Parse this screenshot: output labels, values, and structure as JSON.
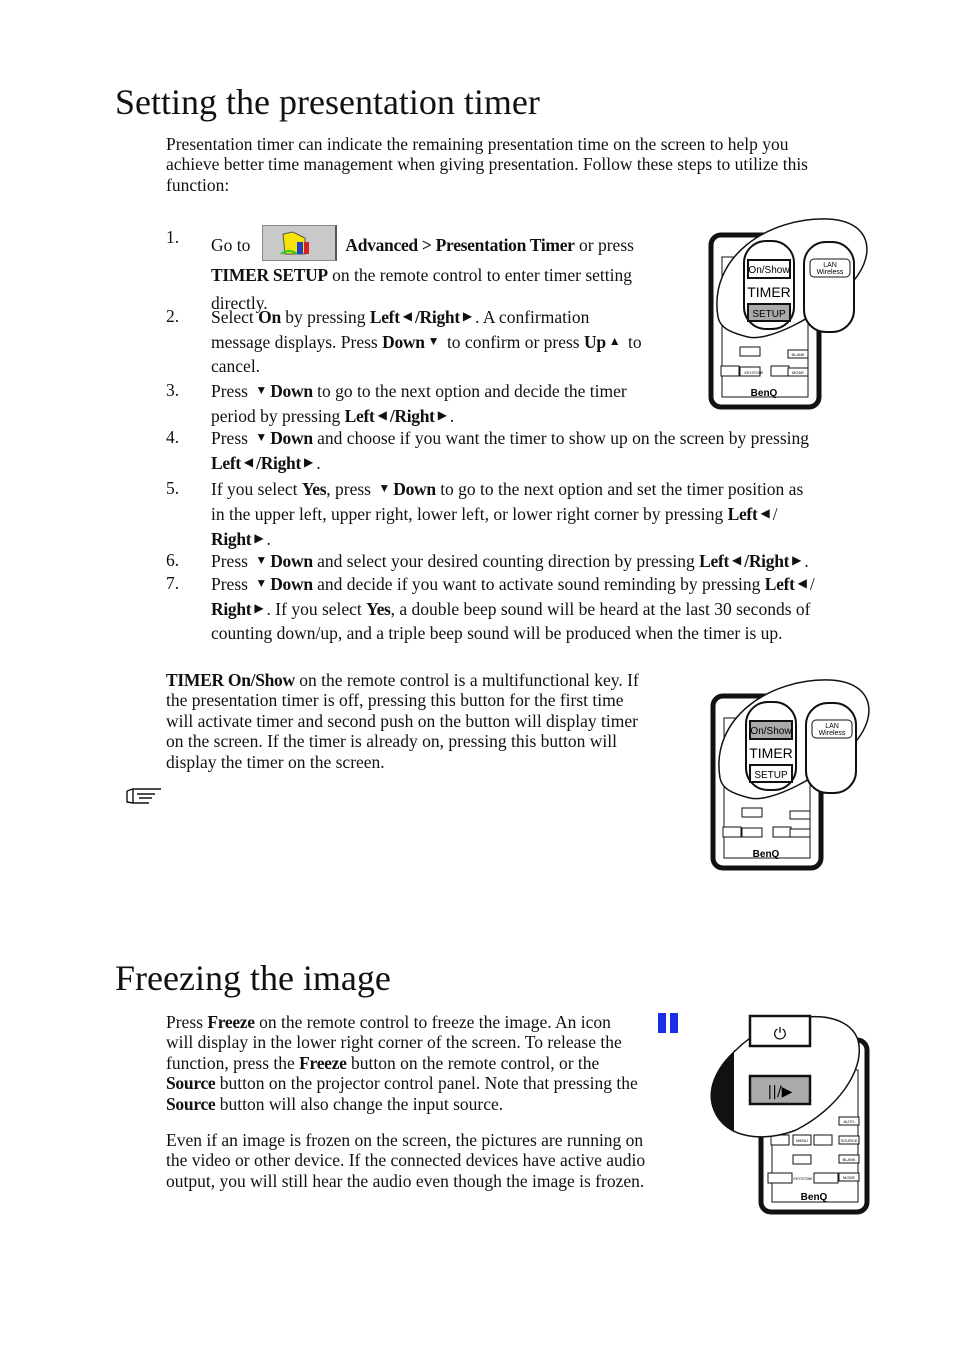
{
  "section1": {
    "title": "Setting the presentation timer",
    "intro": [
      {
        "t": "Presentation timer can indicate the remaining presentation time on the screen to help you"
      },
      {
        "br": 1
      },
      {
        "t": "achieve better time management when giving presentation. Follow these steps to utilize this"
      },
      {
        "br": 1
      },
      {
        "t": "function:"
      }
    ],
    "steps": [
      {
        "num": "1.",
        "segs": [
          {
            "t": "Go to"
          },
          {
            "menuicon": "advanced-menu-icon"
          },
          {
            "t": "Advanced > Presentation Timer",
            "b": 1
          },
          {
            "t": " or press"
          },
          {
            "br": 1
          },
          {
            "t": "TIMER SETUP",
            "b": 1
          },
          {
            "t": " on the remote control to enter timer setting"
          },
          {
            "br": 1
          },
          {
            "t": "directly."
          }
        ]
      },
      {
        "num": "2.",
        "segs": [
          {
            "t": "Select "
          },
          {
            "t": "On",
            "b": 1
          },
          {
            "t": " by pressing "
          },
          {
            "t": "Left",
            "b": 1
          },
          {
            "icon": "left"
          },
          {
            "t": "/Right",
            "b": 1
          },
          {
            "icon": "right"
          },
          {
            "t": ". A confirmation"
          },
          {
            "br": 1
          },
          {
            "t": "message displays. Press "
          },
          {
            "t": "Down",
            "b": 1
          },
          {
            "icon": "down"
          },
          {
            "t": " to confirm or press "
          },
          {
            "t": "Up",
            "b": 1
          },
          {
            "icon": "up"
          },
          {
            "t": " to"
          },
          {
            "br": 1
          },
          {
            "t": "cancel."
          }
        ]
      },
      {
        "num": "3.",
        "segs": [
          {
            "t": "Press "
          },
          {
            "icon": "down"
          },
          {
            "t": "Down",
            "b": 1
          },
          {
            "t": "  to go to the next option and decide the timer"
          },
          {
            "br": 1
          },
          {
            "t": "period by pressing "
          },
          {
            "t": "Left",
            "b": 1
          },
          {
            "icon": "left"
          },
          {
            "t": "/Right",
            "b": 1
          },
          {
            "icon": "right"
          },
          {
            "t": "."
          }
        ]
      },
      {
        "num": "4.",
        "wide": 1,
        "segs": [
          {
            "t": "Press "
          },
          {
            "icon": "down"
          },
          {
            "t": "Down",
            "b": 1
          },
          {
            "t": " and choose if you want the timer to show up on the screen by pressing"
          },
          {
            "br": 1
          },
          {
            "t": "Left",
            "b": 1
          },
          {
            "icon": "left"
          },
          {
            "t": "/Right",
            "b": 1
          },
          {
            "icon": "right"
          },
          {
            "t": "."
          }
        ]
      },
      {
        "num": "5.",
        "wide": 1,
        "segs": [
          {
            "t": "If you select "
          },
          {
            "t": "Yes",
            "b": 1
          },
          {
            "t": ", press "
          },
          {
            "icon": "down"
          },
          {
            "t": "Down",
            "b": 1
          },
          {
            "t": "  to go to the next option and set the timer position as"
          },
          {
            "br": 1
          },
          {
            "t": "in the upper left, upper right, lower left, or lower right corner by pressing "
          },
          {
            "t": "Left",
            "b": 1
          },
          {
            "icon": "left"
          },
          {
            "t": "/"
          },
          {
            "br": 1
          },
          {
            "t": "Right",
            "b": 1
          },
          {
            "icon": "right"
          },
          {
            "t": "."
          }
        ]
      },
      {
        "num": "6.",
        "wide": 1,
        "segs": [
          {
            "t": "Press "
          },
          {
            "icon": "down"
          },
          {
            "t": "Down",
            "b": 1
          },
          {
            "t": " and select your desired counting direction by pressing "
          },
          {
            "t": "Left",
            "b": 1
          },
          {
            "icon": "left"
          },
          {
            "t": "/Right",
            "b": 1
          },
          {
            "icon": "right"
          },
          {
            "t": "."
          }
        ]
      },
      {
        "num": "7.",
        "wide": 1,
        "segs": [
          {
            "t": "Press "
          },
          {
            "icon": "down"
          },
          {
            "t": "Down",
            "b": 1
          },
          {
            "t": " and decide if you want to activate sound reminding by pressing "
          },
          {
            "t": "Left",
            "b": 1
          },
          {
            "icon": "left"
          },
          {
            "t": "/"
          },
          {
            "br": 1
          },
          {
            "t": "Right",
            "b": 1
          },
          {
            "icon": "right"
          },
          {
            "t": ". If you select "
          },
          {
            "t": "Yes",
            "b": 1
          },
          {
            "t": ", a double beep sound will be heard at the last 30 seconds of"
          },
          {
            "br": 1
          },
          {
            "t": "counting down/up, and a triple beep sound will be produced when the timer is up."
          }
        ]
      }
    ],
    "note": [
      {
        "t": "TIMER On/Show",
        "b": 1
      },
      {
        "t": " on the remote control is a multifunctional key. If"
      },
      {
        "br": 1
      },
      {
        "t": "the presentation timer is off, pressing this button for the first time"
      },
      {
        "br": 1
      },
      {
        "t": "will activate timer and second push on the button will display timer"
      },
      {
        "br": 1
      },
      {
        "t": "on the screen. If the timer is already on, pressing this button will"
      },
      {
        "br": 1
      },
      {
        "t": "display the timer on the screen."
      }
    ],
    "remote": {
      "on_show": "On/Show",
      "timer": "TIMER",
      "setup": "SETUP",
      "lan": "LAN",
      "wireless": "Wireless",
      "keystone": "KEYSTONE",
      "blank": "BLANK",
      "mode": "MODE",
      "brand": "BenQ"
    }
  },
  "section2": {
    "title": "Freezing the image",
    "para1": [
      {
        "t": "Press  "
      },
      {
        "t": "Freeze",
        "b": 1
      },
      {
        "t": " on the remote control to freeze the image. An icon"
      },
      {
        "br": 1
      },
      {
        "t": "will display in the lower right corner of the screen. To release the"
      },
      {
        "br": 1
      },
      {
        "t": "function, press the "
      },
      {
        "t": "Freeze",
        "b": 1
      },
      {
        "t": " button on the remote control, or the"
      },
      {
        "br": 1
      },
      {
        "t": "Source",
        "b": 1
      },
      {
        "t": " button on the projector control panel. Note that pressing the"
      },
      {
        "br": 1
      },
      {
        "t": "Source",
        "b": 1
      },
      {
        "t": " button will also change the input source."
      }
    ],
    "para2": [
      {
        "t": "Even if an image is frozen on the screen, the pictures are running on"
      },
      {
        "br": 1
      },
      {
        "t": "the video or other device. If the connected devices have active audio"
      },
      {
        "br": 1
      },
      {
        "t": "output, you will still hear the audio even though the image is frozen."
      }
    ],
    "pause_icon_color": "#1a2ee8",
    "remote": {
      "freeze": "||/▶",
      "menu": "MENU",
      "auto": "AUTO",
      "source": "SOURCE",
      "keystone": "KEYSTONE",
      "blank": "BLANK",
      "mode": "MODE",
      "brand": "BenQ"
    }
  }
}
